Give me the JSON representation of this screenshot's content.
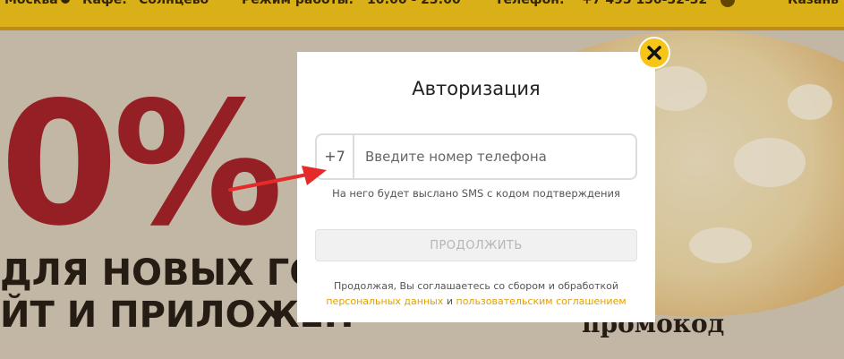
{
  "topbar": {
    "items": [
      "Москва",
      "Кафе:",
      "Солнцево",
      "Режим работы:",
      "10:00 - 23:00",
      "Телефон:",
      "+7 495 150-32-32",
      "Казань"
    ]
  },
  "background": {
    "big_text": "0%",
    "line1": "ДЛЯ НОВЫХ ГОС",
    "line2": "ЙТ И ПРИЛОЖЕН",
    "promo_word": "промокод"
  },
  "modal": {
    "title": "Авторизация",
    "phone_prefix": "+7",
    "phone_placeholder": "Введите номер телефона",
    "phone_value": "",
    "hint": "На него будет выслано SMS с кодом подтверждения",
    "continue_label": "ПРОДОЛЖИТЬ",
    "agree_text": "Продолжая, Вы соглашаетесь со сбором и обработкой",
    "link_personal": "персональных данных",
    "and": "и",
    "link_terms": "пользовательским соглашением"
  },
  "colors": {
    "brand_yellow": "#f2c51a",
    "link": "#e2a000",
    "promo_red": "#a5232a",
    "arrow_red": "#e52a2a"
  },
  "icons": {
    "close": "close-icon",
    "arrow": "arrow-annotation"
  }
}
